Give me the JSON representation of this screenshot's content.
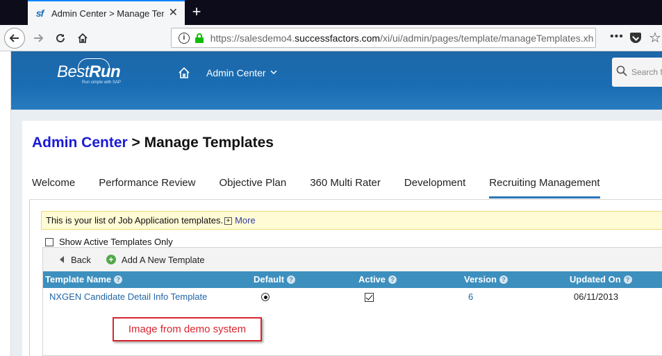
{
  "browser": {
    "tab_favicon": "sf",
    "tab_title": "Admin Center > Manage Temp",
    "tab_close": "✕",
    "new_tab": "+",
    "url_prefix": "https://salesdemo4.",
    "url_domain": "successfactors.com",
    "url_path": "/xi/ui/admin/pages/template/manageTemplates.xh"
  },
  "header": {
    "logo_best": "Best",
    "logo_run": "Run",
    "logo_tagline": "Run simple with SAP",
    "menu_label": "Admin Center",
    "search_placeholder": "Search fo"
  },
  "page": {
    "title_crumb": "Admin Center",
    "title_rest": " > Manage Templates",
    "tabs": [
      {
        "label": "Welcome"
      },
      {
        "label": "Performance Review"
      },
      {
        "label": "Objective Plan"
      },
      {
        "label": "360 Multi Rater"
      },
      {
        "label": "Development"
      },
      {
        "label": "Recruiting Management",
        "active": true
      }
    ],
    "info_text": "This is your list of Job Application templates.",
    "more_label": "More",
    "active_only_label": "Show Active Templates Only",
    "toolbar": {
      "back_label": "Back",
      "add_label": "Add A New Template"
    },
    "columns": [
      "Template Name",
      "Default",
      "Active",
      "Version",
      "Updated On"
    ],
    "rows": [
      {
        "name": "NXGEN Candidate Detail Info Template",
        "default": true,
        "active": true,
        "version": "6",
        "updated_on": "06/11/2013"
      }
    ]
  },
  "annotation": {
    "text": "Image from demo system",
    "color": "#d8262f"
  },
  "colors": {
    "header_blue": "#1a6db3",
    "table_header": "#3d8fbe",
    "breadcrumb_link": "#1a1bd6",
    "info_bar_bg": "#fefbd5"
  }
}
